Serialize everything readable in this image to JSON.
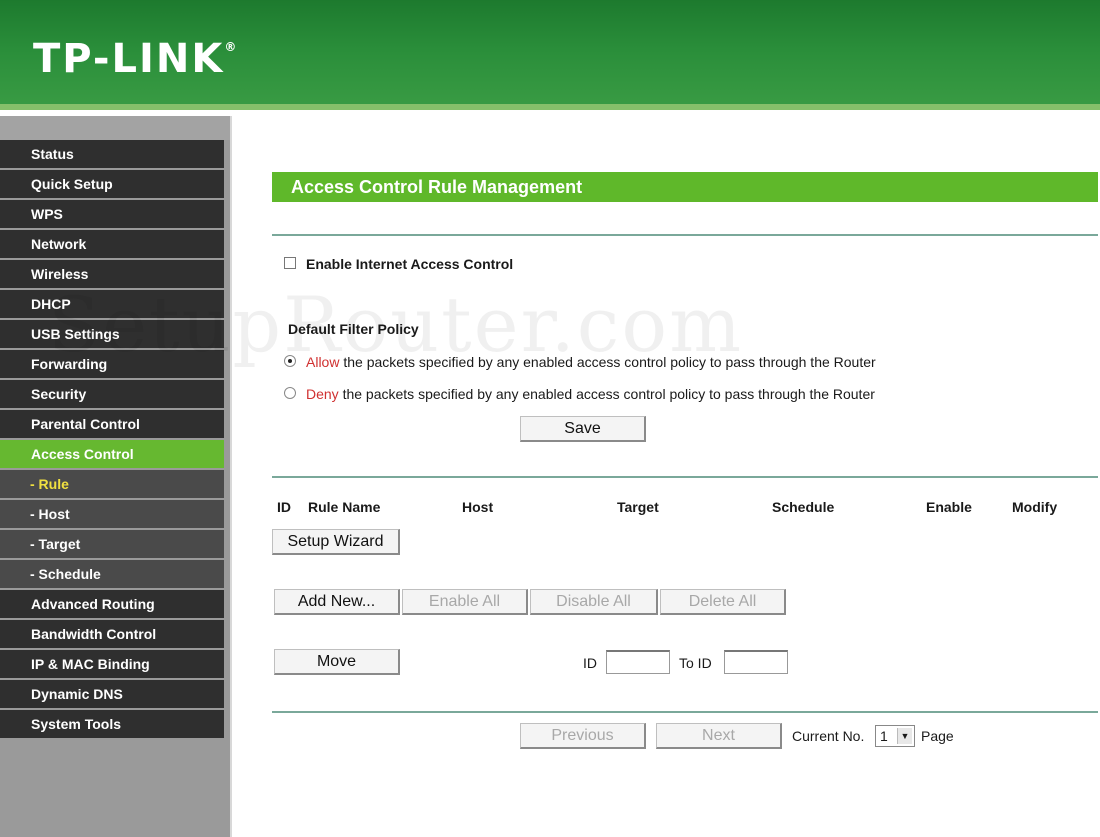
{
  "header": {
    "logo": "TP-LINK",
    "logo_mark": "®"
  },
  "sidebar": {
    "items": [
      {
        "label": "Status"
      },
      {
        "label": "Quick Setup"
      },
      {
        "label": "WPS"
      },
      {
        "label": "Network"
      },
      {
        "label": "Wireless"
      },
      {
        "label": "DHCP"
      },
      {
        "label": "USB Settings"
      },
      {
        "label": "Forwarding"
      },
      {
        "label": "Security"
      },
      {
        "label": "Parental Control"
      },
      {
        "label": "Access Control"
      },
      {
        "label": "- Rule"
      },
      {
        "label": "- Host"
      },
      {
        "label": "- Target"
      },
      {
        "label": "- Schedule"
      },
      {
        "label": "Advanced Routing"
      },
      {
        "label": "Bandwidth Control"
      },
      {
        "label": "IP & MAC Binding"
      },
      {
        "label": "Dynamic DNS"
      },
      {
        "label": "System Tools"
      }
    ]
  },
  "main": {
    "title": "Access Control Rule Management",
    "enable_label": "Enable Internet Access Control",
    "enable_checked": false,
    "policy_label": "Default Filter Policy",
    "allow_word": "Allow",
    "deny_word": "Deny",
    "allow_rest": " the packets specified by any enabled access control policy to pass through the Router",
    "deny_rest": " the packets specified by any enabled access control policy to pass through the Router",
    "selected_policy": "allow",
    "save_label": "Save",
    "columns": [
      "ID",
      "Rule Name",
      "Host",
      "Target",
      "Schedule",
      "Enable",
      "Modify"
    ],
    "setup_wizard_label": "Setup Wizard",
    "add_new_label": "Add New...",
    "enable_all_label": "Enable All",
    "disable_all_label": "Disable All",
    "delete_all_label": "Delete All",
    "move_label": "Move",
    "id_label": "ID",
    "to_id_label": "To ID",
    "previous_label": "Previous",
    "next_label": "Next",
    "current_no_label": "Current No.",
    "current_page": "1",
    "page_label": "Page"
  },
  "watermark": "SetupRouter.com",
  "colors": {
    "header_green": "#2a8e3a",
    "accent_green": "#5fb82a",
    "menu_dark": "#2f2f2f",
    "deny_allow_red": "#d03030"
  }
}
